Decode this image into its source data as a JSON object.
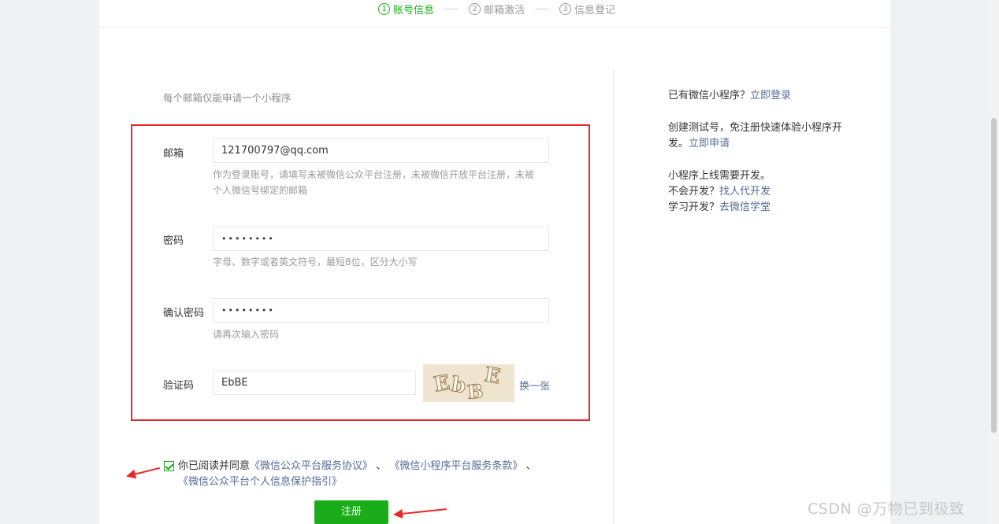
{
  "steps": [
    {
      "num": "1",
      "label": "账号信息"
    },
    {
      "num": "2",
      "label": "邮箱激活"
    },
    {
      "num": "3",
      "label": "信息登记"
    }
  ],
  "form": {
    "hint": "每个邮箱仅能申请一个小程序",
    "email_label": "邮箱",
    "email_value": "121700797@qq.com",
    "email_tip_line1": "作为登录账号，请填写未被微信公众平台注册，未被微信开放平台注册，未被",
    "email_tip_line2": "个人微信号绑定的邮箱",
    "password_label": "密码",
    "password_value": "••••••••",
    "password_tip": "字母、数字或者英文符号，最短8位，区分大小写",
    "confirm_label": "确认密码",
    "confirm_value": "••••••••",
    "confirm_tip": "请再次输入密码",
    "captcha_label": "验证码",
    "captcha_value": "EbBE",
    "captcha_image_text": [
      "E",
      "b",
      "B",
      "E"
    ],
    "captcha_change": "换一张"
  },
  "agreement": {
    "prefix": "你已阅读并同意",
    "link1": "《微信公众平台服务协议》",
    "sep1": "、",
    "link2": "《微信小程序平台服务条款》",
    "sep2": "、",
    "link3": "《微信公众平台个人信息保护指引》",
    "checked": true
  },
  "register_label": "注册",
  "sidebar": {
    "login_prefix": "已有微信小程序？",
    "login_link": "立即登录",
    "test_text_line1": "创建测试号，免注册快速体验小程序开",
    "test_text_line2": "发。",
    "test_link": "立即申请",
    "dev_line1": "小程序上线需要开发。",
    "dev_line2_prefix": "不会开发？",
    "dev_line2_link": "找人代开发",
    "dev_line3_prefix": "学习开发？",
    "dev_line3_link": "去微信学堂"
  },
  "watermark": "CSDN @万物已到极致",
  "colors": {
    "accent": "#1aad19",
    "link": "#576b95",
    "annotation": "#e5282a"
  }
}
